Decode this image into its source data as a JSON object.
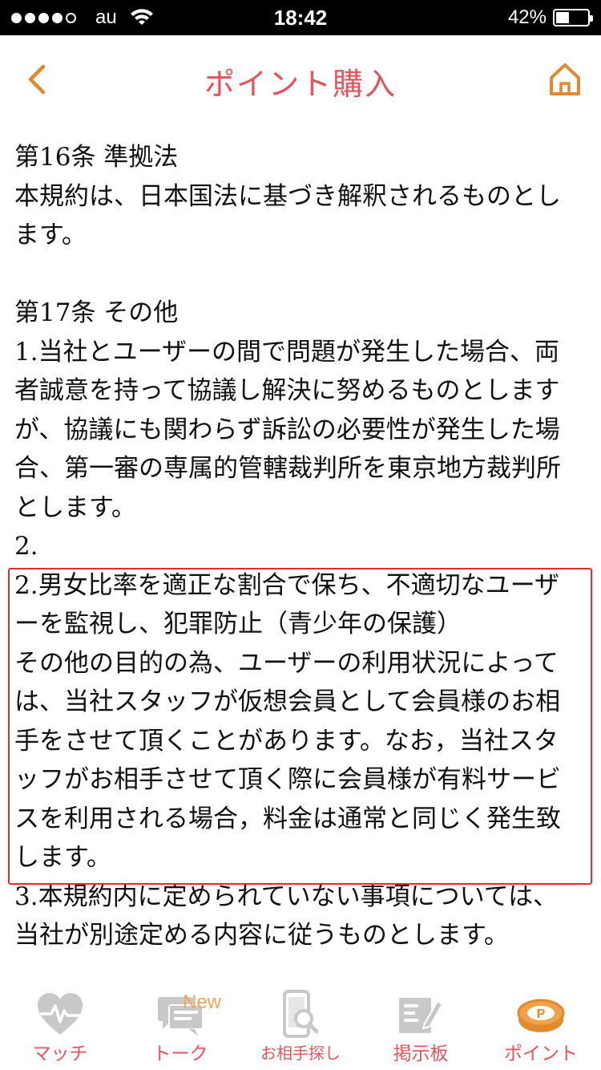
{
  "status_bar": {
    "carrier": "au",
    "time": "18:42",
    "battery_percent": "42%",
    "battery_level": 0.42
  },
  "nav": {
    "title": "ポイント購入"
  },
  "content": {
    "paragraphs": [
      "第16条 準拠法",
      "本規約は、日本国法に基づき解釈されるものとし",
      "ます。",
      "",
      "第17条 その他",
      "1.当社とユーザーの間で問題が発生した場合、両",
      "者誠意を持って協議し解決に努めるものとします",
      "が、協議にも関わらず訴訟の必要性が発生した場",
      "合、第一審の専属的管轄裁判所を東京地方裁判所",
      "とします。",
      "2.",
      "2.男女比率を適正な割合で保ち、不適切なユーザ",
      "ーを監視し、犯罪防止（青少年の保護）",
      "その他の目的の為、ユーザーの利用状況によって",
      "は、当社スタッフが仮想会員として会員様のお相",
      "手をさせて頂くことがあります。なお，当社スタ",
      "ッフがお相手させて頂く際に会員様が有料サービ",
      "スを利用される場合，料金は通常と同じく発生致",
      "します。",
      "3.本規約内に定められていない事項については、",
      "当社が別途定める内容に従うものとします。"
    ]
  },
  "tabs": [
    {
      "label": "マッチ",
      "icon": "heartbeat-icon"
    },
    {
      "label": "トーク",
      "icon": "chat-icon",
      "badge": "New"
    },
    {
      "label": "お相手探し",
      "icon": "phone-search-icon"
    },
    {
      "label": "掲示板",
      "icon": "bulletin-board-icon"
    },
    {
      "label": "ポイント",
      "icon": "point-coin-icon"
    }
  ],
  "colors": {
    "accent": "#e4545e",
    "icon_orange": "#e08a2e",
    "icon_gray": "#c8c8c8",
    "highlight_border": "#e02d2d",
    "badge": "#f3a35b"
  }
}
